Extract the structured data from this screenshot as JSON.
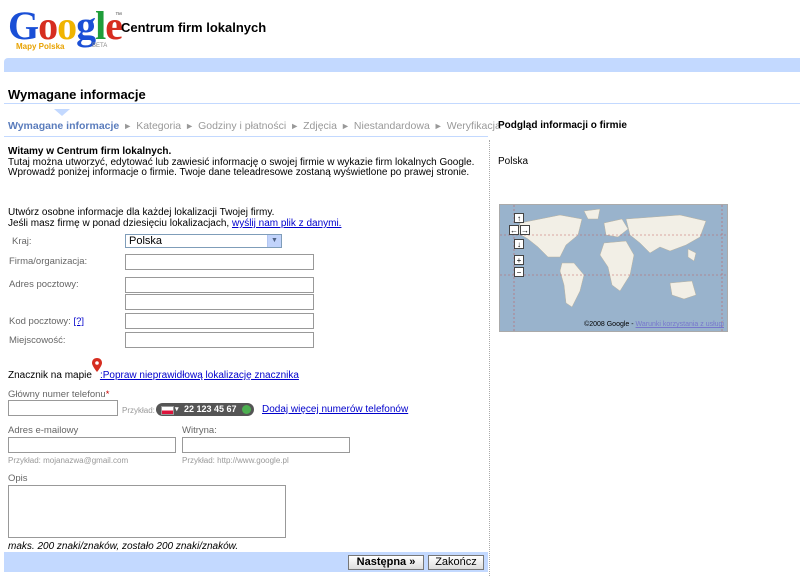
{
  "header": {
    "logo_text": "Google",
    "logo_subtitle": "Mapy Polska",
    "logo_beta": "BETA",
    "logo_tm": "™",
    "app_title": "Centrum firm lokalnych"
  },
  "section": {
    "title": "Wymagane informacje"
  },
  "steps": [
    {
      "label": "Wymagane informacje",
      "active": true
    },
    {
      "label": "Kategoria"
    },
    {
      "label": "Godziny i płatności"
    },
    {
      "label": "Zdjęcia"
    },
    {
      "label": "Niestandardowa"
    },
    {
      "label": "Weryfikacja"
    }
  ],
  "step_arrow": "►",
  "intro": {
    "heading": "Witamy w Centrum firm lokalnych.",
    "body": "Tutaj można utworzyć, edytować lub zawiesić informację o swojej firmie w wykazie firm lokalnych Google. Wprowadź poniżej informacje o firmie. Twoje dane teleadresowe zostaną wyświetlone po prawej stronie."
  },
  "note": {
    "line1": "Utwórz osobne informacje dla każdej lokalizacji Twojej firmy.",
    "line2": "Jeśli masz firmę w ponad dziesięciu lokalizacjach,",
    "link": "wyślij nam plik z danymi."
  },
  "form": {
    "country_label": "Kraj:",
    "country_value": "Polska",
    "company_label": "Firma/organizacja:",
    "address_label": "Adres pocztowy:",
    "postal_label": "Kod pocztowy:",
    "postal_help": "[?]",
    "city_label": "Miejscowość:",
    "marker_label": "Znacznik na mapie",
    "marker_link": ":Popraw nieprawidłową lokalizację znacznika",
    "phone_label": "Główny numer telefonu",
    "phone_required": "*",
    "phone_example_label": "Przykład:",
    "phone_example_number": "22 123 45 67",
    "phone_more_link": "Dodaj więcej numerów telefonów",
    "email_label": "Adres e-mailowy",
    "email_example": "Przykład: mojanazwa@gmail.com",
    "website_label": "Witryna:",
    "website_example": "Przykład: http://www.google.pl",
    "description_label": "Opis",
    "counter": "maks. 200 znaki/znaków, zostało 200 znaki/znaków."
  },
  "buttons": {
    "next": "Następna »",
    "finish": "Zakończ"
  },
  "preview": {
    "title": "Podgląd informacji o firmie",
    "country": "Polska",
    "map_copyright": "©2008 Google -",
    "map_terms": "Warunki korzystania z usługi"
  },
  "colors": {
    "accent_bar": "#c3d9ff",
    "link": "#0000cc"
  }
}
